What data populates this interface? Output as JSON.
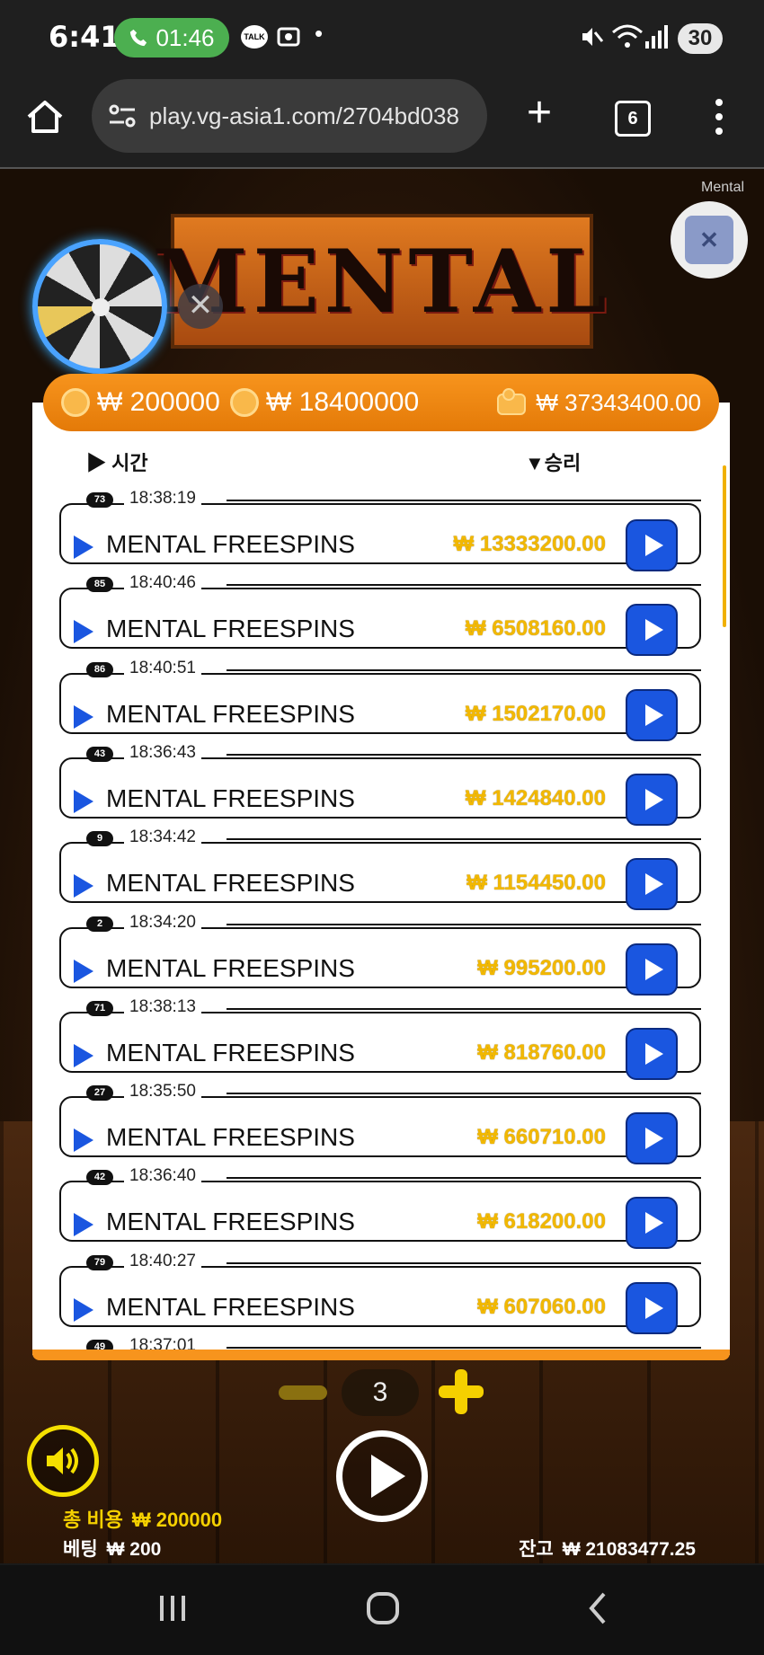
{
  "status_bar": {
    "time": "6:41",
    "call_timer": "01:46",
    "talk_badge": "TALK",
    "battery": "30",
    "icons": [
      "phone-icon",
      "kakaotalk-icon",
      "screenshot-icon",
      "mute-icon",
      "wifi-icon",
      "signal-icon"
    ]
  },
  "browser": {
    "url": "play.vg-asia1.com/2704bd038",
    "tab_count": "6"
  },
  "game": {
    "logo_text": "MENTAL",
    "mini_label": "Mental",
    "close_symbol": "✕",
    "header": {
      "cost": "₩ 200000",
      "won": "₩ 18400000",
      "wallet": "₩ 37343400.00"
    },
    "columns": {
      "time": "시간",
      "win": "승리"
    },
    "rows": [
      {
        "idx": "73",
        "time": "18:38:19",
        "name": "MENTAL FREESPINS",
        "amount": "₩ 13333200.00"
      },
      {
        "idx": "85",
        "time": "18:40:46",
        "name": "MENTAL FREESPINS",
        "amount": "₩ 6508160.00"
      },
      {
        "idx": "86",
        "time": "18:40:51",
        "name": "MENTAL FREESPINS",
        "amount": "₩ 1502170.00"
      },
      {
        "idx": "43",
        "time": "18:36:43",
        "name": "MENTAL FREESPINS",
        "amount": "₩ 1424840.00"
      },
      {
        "idx": "9",
        "time": "18:34:42",
        "name": "MENTAL FREESPINS",
        "amount": "₩ 1154450.00"
      },
      {
        "idx": "2",
        "time": "18:34:20",
        "name": "MENTAL FREESPINS",
        "amount": "₩ 995200.00"
      },
      {
        "idx": "71",
        "time": "18:38:13",
        "name": "MENTAL FREESPINS",
        "amount": "₩ 818760.00"
      },
      {
        "idx": "27",
        "time": "18:35:50",
        "name": "MENTAL FREESPINS",
        "amount": "₩ 660710.00"
      },
      {
        "idx": "42",
        "time": "18:36:40",
        "name": "MENTAL FREESPINS",
        "amount": "₩ 618200.00"
      },
      {
        "idx": "79",
        "time": "18:40:27",
        "name": "MENTAL FREESPINS",
        "amount": "₩ 607060.00"
      },
      {
        "idx": "49",
        "time": "18:37:01",
        "name": "",
        "amount": ""
      }
    ],
    "controls": {
      "count": "3",
      "total_cost_label": "총 비용",
      "total_cost": "₩ 200000",
      "bet_label": "베팅",
      "bet": "₩ 200",
      "balance_label": "잔고",
      "balance": "₩ 21083477.25"
    }
  },
  "colors": {
    "accent_orange": "#f7941d",
    "play_blue": "#1a56e0",
    "amount_gold": "#f2b800"
  }
}
